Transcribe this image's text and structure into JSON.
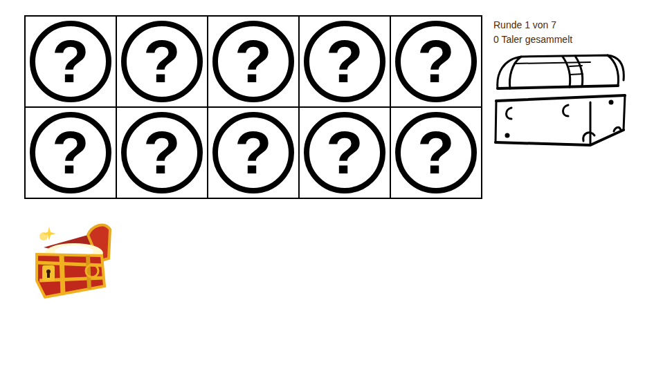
{
  "status": {
    "round": "Runde 1 von 7",
    "coins": "0 Taler gesammelt"
  },
  "cards": [
    {
      "symbol": "?",
      "revealed": false
    },
    {
      "symbol": "?",
      "revealed": false
    },
    {
      "symbol": "?",
      "revealed": false
    },
    {
      "symbol": "?",
      "revealed": false
    },
    {
      "symbol": "?",
      "revealed": false
    },
    {
      "symbol": "?",
      "revealed": false
    },
    {
      "symbol": "?",
      "revealed": false
    },
    {
      "symbol": "?",
      "revealed": false
    },
    {
      "symbol": "?",
      "revealed": false
    },
    {
      "symbol": "?",
      "revealed": false
    }
  ]
}
